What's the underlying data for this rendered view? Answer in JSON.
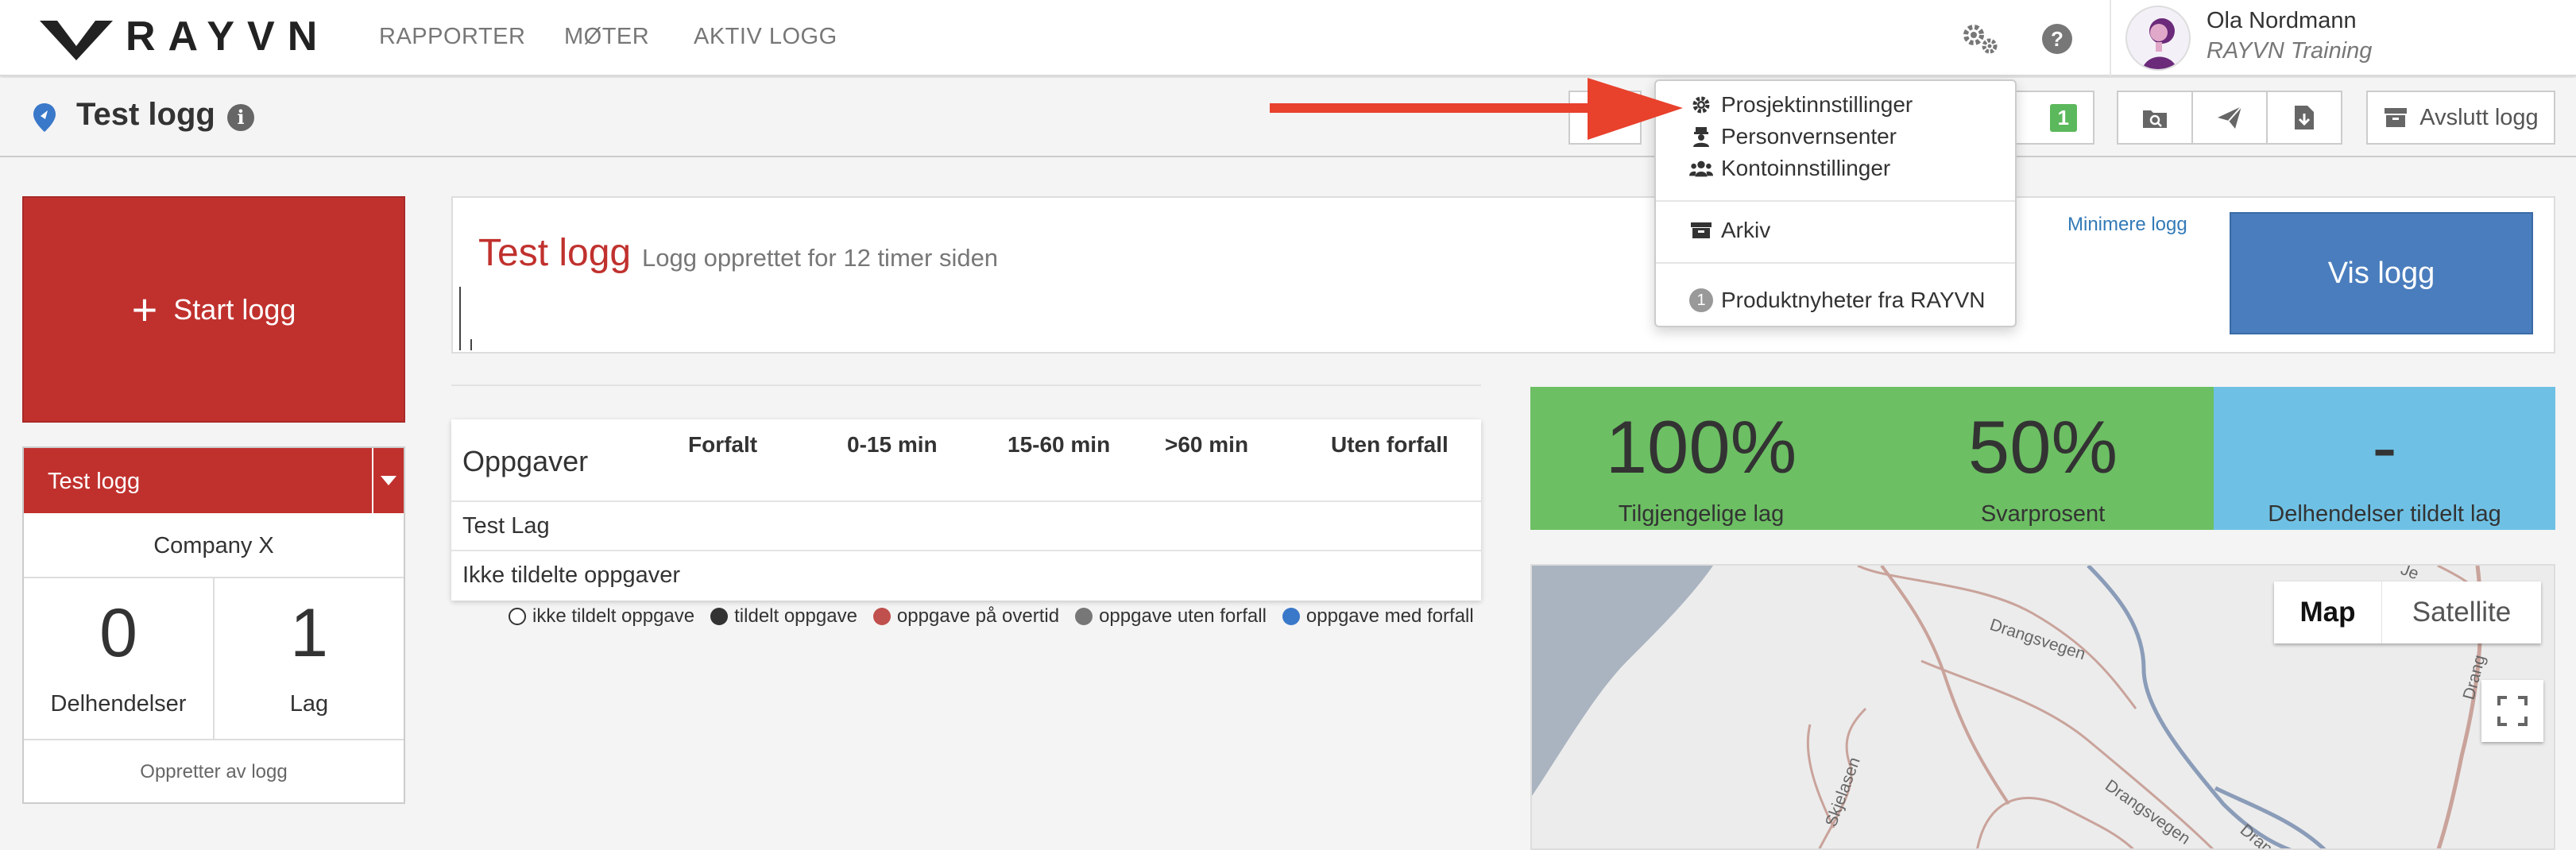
{
  "brand": {
    "name": "RAYVN"
  },
  "nav": {
    "links": [
      "RAPPORTER",
      "MØTER",
      "AKTIV LOGG"
    ]
  },
  "user": {
    "name": "Ola Nordmann",
    "org": "RAYVN Training"
  },
  "header": {
    "title": "Test logg",
    "badge_count": "1",
    "end_log_label": "Avslutt logg"
  },
  "start_log": {
    "label": "Start logg"
  },
  "log_card": {
    "title": "Test logg",
    "company": "Company X",
    "stats": [
      {
        "value": "0",
        "label": "Delhendelser"
      },
      {
        "value": "1",
        "label": "Lag"
      }
    ],
    "creator_label": "Oppretter av logg"
  },
  "log_panel": {
    "title": "Test logg",
    "subtitle": "Logg opprettet for 12 timer siden",
    "minimize_label": "Minimere logg",
    "view_label": "Vis logg"
  },
  "tasks": {
    "title": "Oppgaver",
    "columns": [
      "Forfalt",
      "0-15 min",
      "15-60 min",
      ">60 min",
      "Uten forfall"
    ],
    "rows": [
      "Test Lag",
      "Ikke tildelte oppgaver"
    ]
  },
  "legend": [
    {
      "label": "ikke tildelt oppgave",
      "color": "#ffffff"
    },
    {
      "label": "tildelt oppgave",
      "color": "#333333"
    },
    {
      "label": "oppgave på overtid",
      "color": "#c0504d"
    },
    {
      "label": "oppgave uten forfall",
      "color": "#777777"
    },
    {
      "label": "oppgave med forfall",
      "color": "#3a78c9"
    }
  ],
  "kpis": [
    {
      "value": "100%",
      "label": "Tilgjengelige lag",
      "color": "#6cbf63"
    },
    {
      "value": "50%",
      "label": "Svarprosent",
      "color": "#6cbf63"
    },
    {
      "value": "-",
      "label": "Delhendelser tildelt lag",
      "color": "#6ec1e4"
    }
  ],
  "map": {
    "type_options": [
      "Map",
      "Satellite"
    ],
    "selected_type": "Map",
    "road_labels": [
      "Drangsvegen",
      "Drangsvegen",
      "Skjelasen",
      "Drang",
      "Drang",
      "Je"
    ]
  },
  "dropdown": {
    "items": [
      {
        "label": "Prosjektinnstillinger",
        "icon": "gear-icon"
      },
      {
        "label": "Personvernsenter",
        "icon": "person-lock-icon"
      },
      {
        "label": "Kontoinnstillinger",
        "icon": "users-icon"
      },
      {
        "label": "Arkiv",
        "icon": "archive-icon"
      },
      {
        "label": "Produktnyheter fra RAYVN",
        "icon": "news-count-icon",
        "count": "1"
      }
    ]
  },
  "colors": {
    "brand_red": "#c0312e",
    "link_blue": "#337ab7",
    "button_blue": "#4a7dbd",
    "annotation_arrow": "#e8412c"
  }
}
